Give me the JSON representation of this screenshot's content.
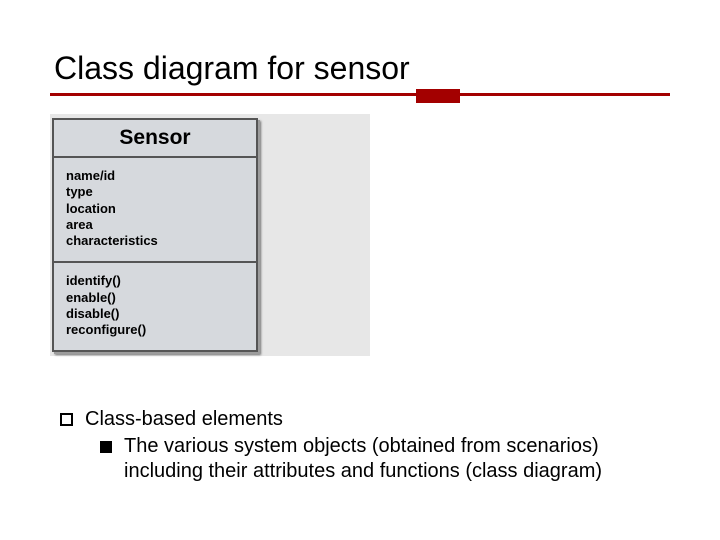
{
  "title": "Class diagram for sensor",
  "uml": {
    "class_name": "Sensor",
    "attributes": [
      "name/id",
      "type",
      "location",
      "area",
      "characteristics"
    ],
    "operations": [
      "identify()",
      "enable()",
      "disable()",
      "reconfigure()"
    ]
  },
  "bullets": {
    "level1": "Class-based elements",
    "level2": "The various system objects (obtained from scenarios) including their attributes and functions (class diagram)"
  }
}
